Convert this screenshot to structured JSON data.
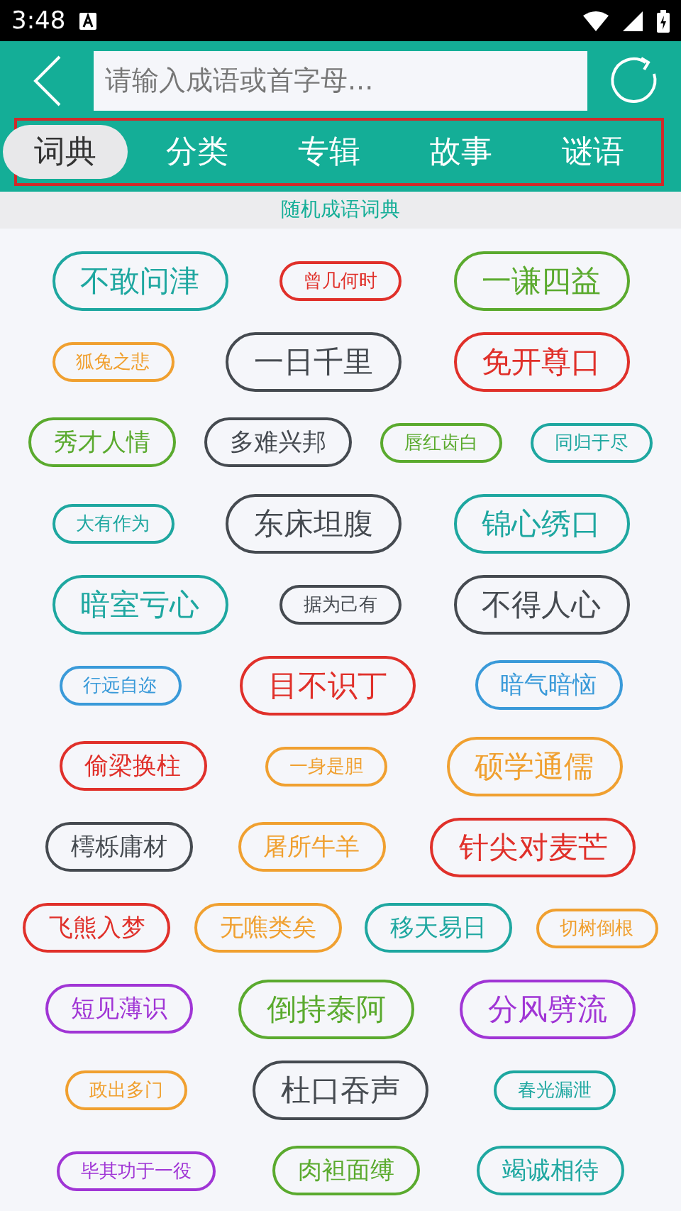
{
  "status_bar": {
    "time": "3:48"
  },
  "search": {
    "placeholder": "请输入成语或首字母..."
  },
  "tabs": [
    {
      "label": "词典",
      "selected": true
    },
    {
      "label": "分类",
      "selected": false
    },
    {
      "label": "专辑",
      "selected": false
    },
    {
      "label": "故事",
      "selected": false
    },
    {
      "label": "谜语",
      "selected": false
    }
  ],
  "section_title": "随机成语词典",
  "idiom_rows": [
    [
      {
        "text": "不敢问津",
        "kind": "large",
        "color": "#1ea7a0"
      },
      {
        "text": "曾几何时",
        "kind": "small",
        "color": "#e0302a"
      },
      {
        "text": "一谦四益",
        "kind": "large",
        "color": "#5aaa2e"
      }
    ],
    [
      {
        "text": "狐兔之悲",
        "kind": "small",
        "color": "#f0a030"
      },
      {
        "text": "一日千里",
        "kind": "large",
        "color": "#454a50"
      },
      {
        "text": "免开尊口",
        "kind": "large",
        "color": "#e0302a"
      }
    ],
    [
      {
        "text": "秀才人情",
        "kind": "medium",
        "color": "#5aaa2e"
      },
      {
        "text": "多难兴邦",
        "kind": "medium",
        "color": "#454a50"
      },
      {
        "text": "唇红齿白",
        "kind": "small",
        "color": "#5aaa2e"
      },
      {
        "text": "同归于尽",
        "kind": "small",
        "color": "#1ea7a0"
      }
    ],
    [
      {
        "text": "大有作为",
        "kind": "small",
        "color": "#1ea7a0"
      },
      {
        "text": "东床坦腹",
        "kind": "large",
        "color": "#454a50"
      },
      {
        "text": "锦心绣口",
        "kind": "large",
        "color": "#1ea7a0"
      }
    ],
    [
      {
        "text": "暗室亏心",
        "kind": "large",
        "color": "#1ea7a0"
      },
      {
        "text": "据为己有",
        "kind": "small",
        "color": "#454a50"
      },
      {
        "text": "不得人心",
        "kind": "large",
        "color": "#454a50"
      }
    ],
    [
      {
        "text": "行远自迩",
        "kind": "small",
        "color": "#3a9ad9"
      },
      {
        "text": "目不识丁",
        "kind": "large",
        "color": "#e0302a"
      },
      {
        "text": "暗气暗恼",
        "kind": "medium",
        "color": "#3a9ad9"
      }
    ],
    [
      {
        "text": "偷梁换柱",
        "kind": "medium",
        "color": "#e0302a"
      },
      {
        "text": "一身是胆",
        "kind": "small",
        "color": "#f0a030"
      },
      {
        "text": "硕学通儒",
        "kind": "large",
        "color": "#f0a030"
      }
    ],
    [
      {
        "text": "樗栎庸材",
        "kind": "medium",
        "color": "#454a50"
      },
      {
        "text": "屠所牛羊",
        "kind": "medium",
        "color": "#f0a030"
      },
      {
        "text": "针尖对麦芒",
        "kind": "large",
        "color": "#e0302a"
      }
    ],
    [
      {
        "text": "飞熊入梦",
        "kind": "medium",
        "color": "#e0302a"
      },
      {
        "text": "无噍类矣",
        "kind": "medium",
        "color": "#f0a030"
      },
      {
        "text": "移天易日",
        "kind": "medium",
        "color": "#1ea7a0"
      },
      {
        "text": "切树倒根",
        "kind": "small",
        "color": "#f0a030"
      }
    ],
    [
      {
        "text": "短见薄识",
        "kind": "medium",
        "color": "#a035d5"
      },
      {
        "text": "倒持泰阿",
        "kind": "large",
        "color": "#5aaa2e"
      },
      {
        "text": "分风劈流",
        "kind": "large",
        "color": "#a035d5"
      }
    ],
    [
      {
        "text": "政出多门",
        "kind": "small",
        "color": "#f0a030"
      },
      {
        "text": "杜口吞声",
        "kind": "large",
        "color": "#454a50"
      },
      {
        "text": "春光漏泄",
        "kind": "small",
        "color": "#1ea7a0"
      }
    ],
    [
      {
        "text": "毕其功于一役",
        "kind": "small",
        "color": "#a035d5"
      },
      {
        "text": "肉袒面缚",
        "kind": "medium",
        "color": "#5aaa2e"
      },
      {
        "text": "竭诚相待",
        "kind": "medium",
        "color": "#1ea7a0"
      }
    ]
  ]
}
